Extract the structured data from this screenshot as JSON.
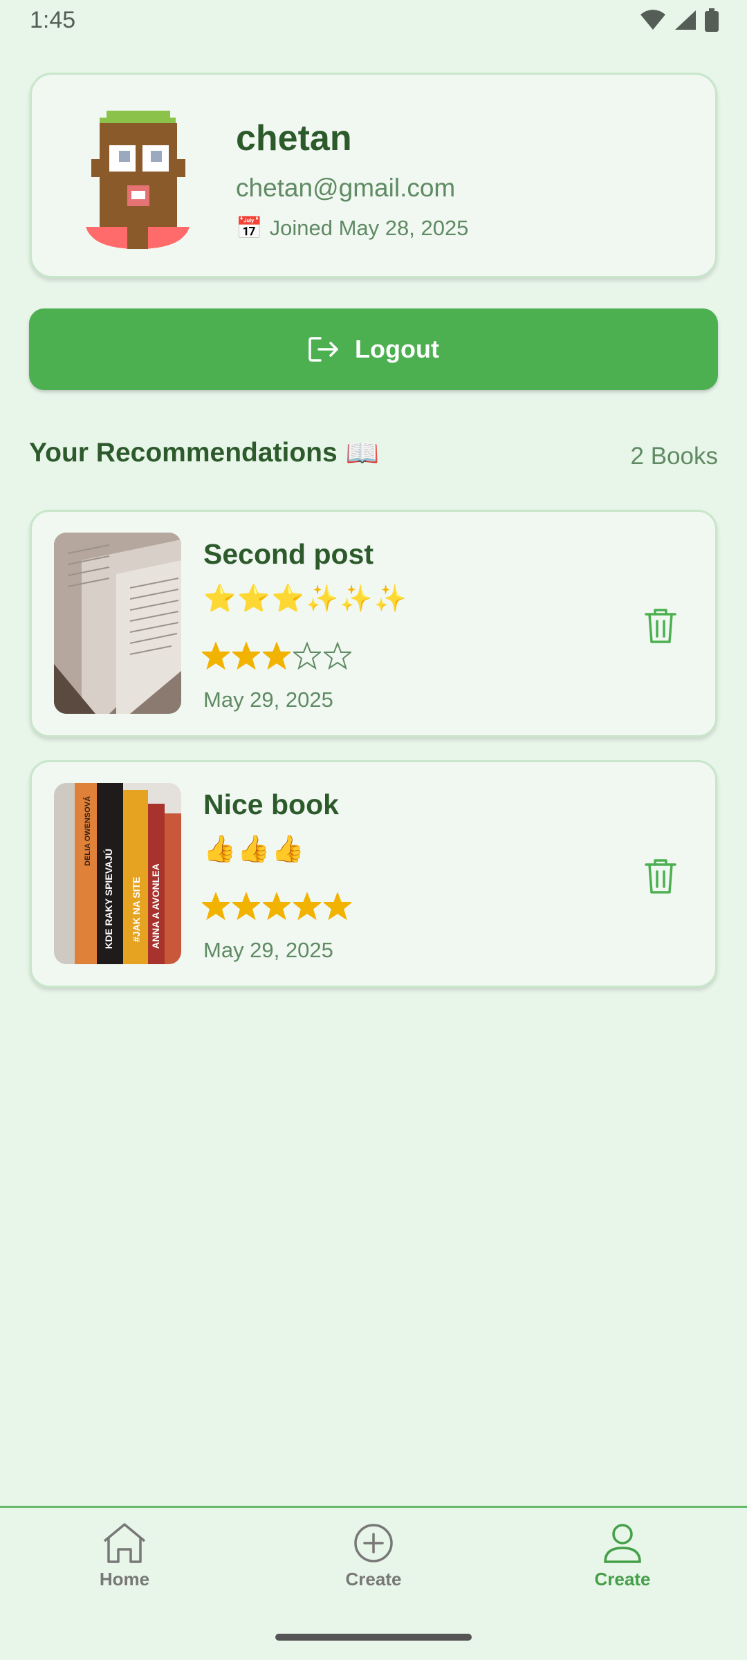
{
  "status_bar": {
    "time": "1:45",
    "icons": [
      "wifi-icon",
      "signal-icon",
      "battery-icon"
    ]
  },
  "profile": {
    "name": "chetan",
    "email": "chetan@gmail.com",
    "joined_icon": "📅",
    "joined": "Joined May 28, 2025"
  },
  "logout": {
    "label": "Logout",
    "icon": "logout-icon"
  },
  "section": {
    "title": "Your Recommendations",
    "title_icon": "📖",
    "count": "2 Books"
  },
  "books": [
    {
      "title": "Second post",
      "caption": "⭐⭐⭐✨✨✨",
      "rating": 3,
      "max_rating": 5,
      "date": "May 29, 2025"
    },
    {
      "title": "Nice book",
      "caption": "👍👍👍",
      "rating": 5,
      "max_rating": 5,
      "date": "May 29, 2025"
    }
  ],
  "nav": {
    "items": [
      {
        "label": "Home",
        "icon": "home-icon"
      },
      {
        "label": "Create",
        "icon": "plus-circle-icon"
      },
      {
        "label": "Create",
        "icon": "profile-icon",
        "active": true
      }
    ]
  },
  "colors": {
    "accent": "#4caf50",
    "background": "#e8f5e9",
    "text_dark": "#2d5a2b",
    "text_muted": "#5f8a63",
    "star": "#f2b200"
  }
}
